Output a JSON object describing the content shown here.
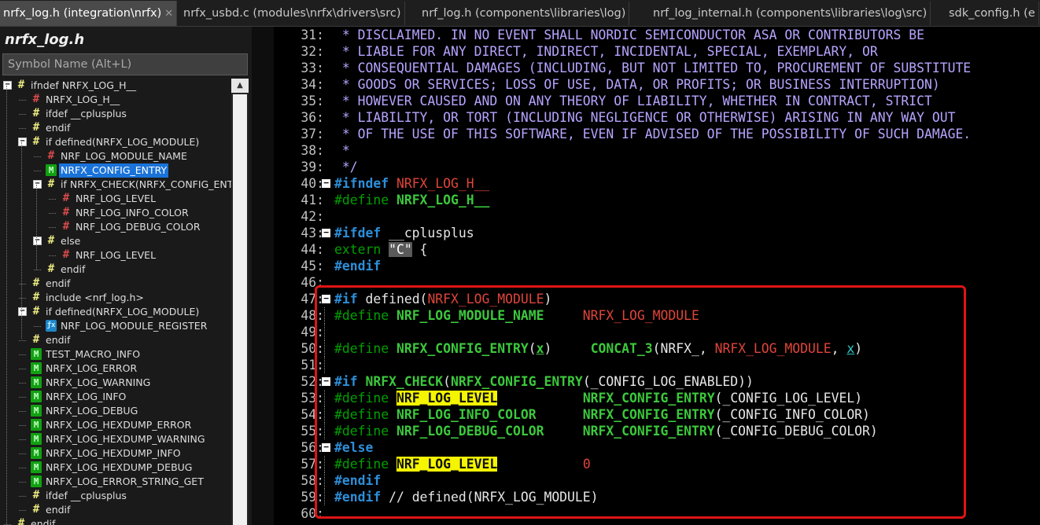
{
  "tabs": [
    {
      "label": "nrfx_log.h (integration\\nrfx)",
      "active": true,
      "close": "✕"
    },
    {
      "label": "nrfx_usbd.c (modules\\nrfx\\drivers\\src)"
    },
    {
      "label": "nrf_log.h (components\\libraries\\log)"
    },
    {
      "label": "nrf_log_internal.h (components\\libraries\\log\\src)"
    },
    {
      "label": "sdk_config.h (e"
    }
  ],
  "symbol_pane": {
    "title": "nrfx_log.h",
    "search_placeholder": "Symbol Name (Alt+L)"
  },
  "tree": [
    {
      "label": "ifndef NRFX_LOG_H__",
      "icon": "hash",
      "depth": 0,
      "toggle": "−"
    },
    {
      "label": "NRFX_LOG_H__",
      "icon": "hashred",
      "depth": 1
    },
    {
      "label": "ifdef __cplusplus",
      "icon": "hash",
      "depth": 1
    },
    {
      "label": "endif",
      "icon": "hash",
      "depth": 1
    },
    {
      "label": "if defined(NRFX_LOG_MODULE)",
      "icon": "hash",
      "depth": 1,
      "toggle": "−"
    },
    {
      "label": "NRF_LOG_MODULE_NAME",
      "icon": "hashred",
      "depth": 2
    },
    {
      "label": "NRFX_CONFIG_ENTRY",
      "icon": "macro",
      "depth": 2,
      "selected": true
    },
    {
      "label": "if NRFX_CHECK(NRFX_CONFIG_ENTRY",
      "icon": "hash",
      "depth": 2,
      "toggle": "−"
    },
    {
      "label": "NRF_LOG_LEVEL",
      "icon": "hashred",
      "depth": 3
    },
    {
      "label": "NRF_LOG_INFO_COLOR",
      "icon": "hashred",
      "depth": 3
    },
    {
      "label": "NRF_LOG_DEBUG_COLOR",
      "icon": "hashred",
      "depth": 3
    },
    {
      "label": "else",
      "icon": "hash",
      "depth": 2,
      "toggle": "−"
    },
    {
      "label": "NRF_LOG_LEVEL",
      "icon": "hashred",
      "depth": 3
    },
    {
      "label": "endif",
      "icon": "hash",
      "depth": 2
    },
    {
      "label": "endif",
      "icon": "hash",
      "depth": 1
    },
    {
      "label": "include <nrf_log.h>",
      "icon": "hash",
      "depth": 1
    },
    {
      "label": "if defined(NRFX_LOG_MODULE)",
      "icon": "hash",
      "depth": 1,
      "toggle": "−"
    },
    {
      "label": "NRF_LOG_MODULE_REGISTER",
      "icon": "func",
      "depth": 2
    },
    {
      "label": "endif",
      "icon": "hash",
      "depth": 1
    },
    {
      "label": "TEST_MACRO_INFO",
      "icon": "macro",
      "depth": 1
    },
    {
      "label": "NRFX_LOG_ERROR",
      "icon": "macro",
      "depth": 1
    },
    {
      "label": "NRFX_LOG_WARNING",
      "icon": "macro",
      "depth": 1
    },
    {
      "label": "NRFX_LOG_INFO",
      "icon": "macro",
      "depth": 1
    },
    {
      "label": "NRFX_LOG_DEBUG",
      "icon": "macro",
      "depth": 1
    },
    {
      "label": "NRFX_LOG_HEXDUMP_ERROR",
      "icon": "macro",
      "depth": 1
    },
    {
      "label": "NRFX_LOG_HEXDUMP_WARNING",
      "icon": "macro",
      "depth": 1
    },
    {
      "label": "NRFX_LOG_HEXDUMP_INFO",
      "icon": "macro",
      "depth": 1
    },
    {
      "label": "NRFX_LOG_HEXDUMP_DEBUG",
      "icon": "macro",
      "depth": 1
    },
    {
      "label": "NRFX_LOG_ERROR_STRING_GET",
      "icon": "macro",
      "depth": 1
    },
    {
      "label": "ifdef __cplusplus",
      "icon": "hash",
      "depth": 1
    },
    {
      "label": "endif",
      "icon": "hash",
      "depth": 1
    },
    {
      "label": "endif",
      "icon": "hash",
      "depth": 0
    }
  ],
  "code": [
    {
      "n": "31:",
      "s": [
        [
          "comment",
          " * DISCLAIMED. IN NO EVENT SHALL NORDIC SEMICONDUCTOR ASA OR CONTRIBUTORS BE"
        ]
      ]
    },
    {
      "n": "32:",
      "s": [
        [
          "comment",
          " * LIABLE FOR ANY DIRECT, INDIRECT, INCIDENTAL, SPECIAL, EXEMPLARY, OR"
        ]
      ]
    },
    {
      "n": "33:",
      "s": [
        [
          "comment",
          " * CONSEQUENTIAL DAMAGES (INCLUDING, BUT NOT LIMITED TO, PROCUREMENT OF SUBSTITUTE"
        ]
      ]
    },
    {
      "n": "34:",
      "s": [
        [
          "comment",
          " * GOODS OR SERVICES; LOSS OF USE, DATA, OR PROFITS; OR BUSINESS INTERRUPTION)"
        ]
      ]
    },
    {
      "n": "35:",
      "s": [
        [
          "comment",
          " * HOWEVER CAUSED AND ON ANY THEORY OF LIABILITY, WHETHER IN CONTRACT, STRICT"
        ]
      ]
    },
    {
      "n": "36:",
      "s": [
        [
          "comment",
          " * LIABILITY, OR TORT (INCLUDING NEGLIGENCE OR OTHERWISE) ARISING IN ANY WAY OUT"
        ]
      ]
    },
    {
      "n": "37:",
      "s": [
        [
          "comment",
          " * OF THE USE OF THIS SOFTWARE, EVEN IF ADVISED OF THE POSSIBILITY OF SUCH DAMAGE."
        ]
      ]
    },
    {
      "n": "38:",
      "s": [
        [
          "comment",
          " *"
        ]
      ]
    },
    {
      "n": "39:",
      "s": [
        [
          "comment",
          " */"
        ]
      ]
    },
    {
      "n": "40:",
      "fold": "−",
      "s": [
        [
          "kw",
          "#ifndef "
        ],
        [
          "red",
          "NRFX_LOG_H__"
        ]
      ]
    },
    {
      "n": "41:",
      "s": [
        [
          "dir",
          "#define "
        ],
        [
          "green",
          "NRFX_LOG_H__"
        ]
      ]
    },
    {
      "n": "42:",
      "s": []
    },
    {
      "n": "43:",
      "fold": "−",
      "s": [
        [
          "kw",
          "#ifdef "
        ],
        [
          "white",
          "__cplusplus"
        ]
      ]
    },
    {
      "n": "44:",
      "s": [
        [
          "dir",
          "extern "
        ],
        [
          "str",
          "\"C\""
        ],
        [
          "white",
          " {"
        ]
      ]
    },
    {
      "n": "45:",
      "s": [
        [
          "kw",
          "#endif"
        ]
      ]
    },
    {
      "n": "46:",
      "s": []
    },
    {
      "n": "47:",
      "fold": "−",
      "s": [
        [
          "kw",
          "#if "
        ],
        [
          "white",
          "defined("
        ],
        [
          "red",
          "NRFX_LOG_MODULE"
        ],
        [
          "white",
          ")"
        ]
      ]
    },
    {
      "n": "48:",
      "dots": true,
      "s": [
        [
          "dir",
          "#define "
        ],
        [
          "green",
          "NRF_LOG_MODULE_NAME"
        ],
        [
          "white",
          "     "
        ],
        [
          "red",
          "NRFX_LOG_MODULE"
        ]
      ]
    },
    {
      "n": "49:",
      "dots": true,
      "s": []
    },
    {
      "n": "50:",
      "dots": true,
      "s": [
        [
          "dir",
          "#define "
        ],
        [
          "green",
          "NRFX_CONFIG_ENTRY"
        ],
        [
          "white",
          "("
        ],
        [
          "green u",
          "x"
        ],
        [
          "white",
          ")     "
        ],
        [
          "green",
          "CONCAT_3"
        ],
        [
          "white",
          "(NRFX_, "
        ],
        [
          "red",
          "NRFX_LOG_MODULE"
        ],
        [
          "white",
          ", "
        ],
        [
          "cyan u",
          "x"
        ],
        [
          "white",
          ")"
        ]
      ]
    },
    {
      "n": "51:",
      "dots": true,
      "s": []
    },
    {
      "n": "52:",
      "fold": "−",
      "s": [
        [
          "kw",
          "#if "
        ],
        [
          "green",
          "NRFX_CHECK"
        ],
        [
          "white",
          "("
        ],
        [
          "green",
          "NRFX_CONFIG_ENTRY"
        ],
        [
          "white",
          "(_CONFIG_LOG_ENABLED))"
        ]
      ]
    },
    {
      "n": "53:",
      "dots": true,
      "s": [
        [
          "dir",
          "#define "
        ],
        [
          "hl",
          "NRF_LOG_LEVEL"
        ],
        [
          "white",
          "           "
        ],
        [
          "green",
          "NRFX_CONFIG_ENTRY"
        ],
        [
          "white",
          "(_CONFIG_LOG_LEVEL)"
        ]
      ]
    },
    {
      "n": "54:",
      "dots": true,
      "s": [
        [
          "dir",
          "#define "
        ],
        [
          "green",
          "NRF_LOG_INFO_COLOR"
        ],
        [
          "white",
          "      "
        ],
        [
          "green",
          "NRFX_CONFIG_ENTRY"
        ],
        [
          "white",
          "(_CONFIG_INFO_COLOR)"
        ]
      ]
    },
    {
      "n": "55:",
      "dots": true,
      "s": [
        [
          "dir",
          "#define "
        ],
        [
          "green",
          "NRF_LOG_DEBUG_COLOR"
        ],
        [
          "white",
          "     "
        ],
        [
          "green",
          "NRFX_CONFIG_ENTRY"
        ],
        [
          "white",
          "(_CONFIG_DEBUG_COLOR)"
        ]
      ]
    },
    {
      "n": "56:",
      "fold": "−",
      "s": [
        [
          "kw",
          "#else"
        ]
      ]
    },
    {
      "n": "57:",
      "dots": true,
      "s": [
        [
          "dir",
          "#define "
        ],
        [
          "hl",
          "NRF_LOG_LEVEL"
        ],
        [
          "white",
          "           "
        ],
        [
          "red",
          "0"
        ]
      ]
    },
    {
      "n": "58:",
      "dots": true,
      "s": [
        [
          "kw",
          "#endif"
        ]
      ]
    },
    {
      "n": "59:",
      "dots": true,
      "s": [
        [
          "kw",
          "#endif"
        ],
        [
          "white",
          " // defined(NRFX_LOG_MODULE)"
        ]
      ]
    },
    {
      "n": "60:",
      "s": []
    }
  ]
}
